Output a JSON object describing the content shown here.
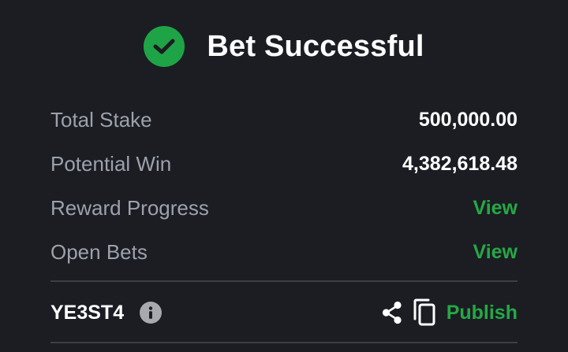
{
  "header": {
    "title": "Bet Successful",
    "status_color": "#1ea446"
  },
  "summary": {
    "rows": [
      {
        "label": "Total Stake",
        "value": "500,000.00"
      },
      {
        "label": "Potential Win",
        "value": "4,382,618.48"
      },
      {
        "label": "Reward Progress",
        "link": "View"
      },
      {
        "label": "Open Bets",
        "link": "View"
      }
    ]
  },
  "booking": {
    "code": "YE3ST4",
    "publish_label": "Publish",
    "icons": [
      "info-icon",
      "share-icon",
      "copy-icon"
    ]
  },
  "colors": {
    "background": "#1b1d23",
    "accent": "#26a845",
    "muted_text": "#9da1ab"
  }
}
